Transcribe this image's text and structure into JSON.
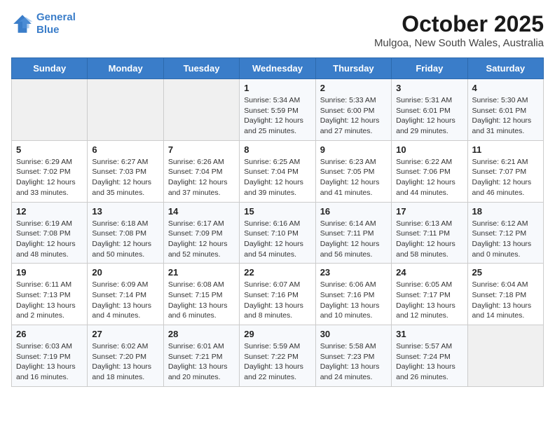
{
  "logo": {
    "line1": "General",
    "line2": "Blue"
  },
  "title": "October 2025",
  "subtitle": "Mulgoa, New South Wales, Australia",
  "days_of_week": [
    "Sunday",
    "Monday",
    "Tuesday",
    "Wednesday",
    "Thursday",
    "Friday",
    "Saturday"
  ],
  "weeks": [
    [
      {
        "day": "",
        "info": ""
      },
      {
        "day": "",
        "info": ""
      },
      {
        "day": "",
        "info": ""
      },
      {
        "day": "1",
        "info": "Sunrise: 5:34 AM\nSunset: 5:59 PM\nDaylight: 12 hours\nand 25 minutes."
      },
      {
        "day": "2",
        "info": "Sunrise: 5:33 AM\nSunset: 6:00 PM\nDaylight: 12 hours\nand 27 minutes."
      },
      {
        "day": "3",
        "info": "Sunrise: 5:31 AM\nSunset: 6:01 PM\nDaylight: 12 hours\nand 29 minutes."
      },
      {
        "day": "4",
        "info": "Sunrise: 5:30 AM\nSunset: 6:01 PM\nDaylight: 12 hours\nand 31 minutes."
      }
    ],
    [
      {
        "day": "5",
        "info": "Sunrise: 6:29 AM\nSunset: 7:02 PM\nDaylight: 12 hours\nand 33 minutes."
      },
      {
        "day": "6",
        "info": "Sunrise: 6:27 AM\nSunset: 7:03 PM\nDaylight: 12 hours\nand 35 minutes."
      },
      {
        "day": "7",
        "info": "Sunrise: 6:26 AM\nSunset: 7:04 PM\nDaylight: 12 hours\nand 37 minutes."
      },
      {
        "day": "8",
        "info": "Sunrise: 6:25 AM\nSunset: 7:04 PM\nDaylight: 12 hours\nand 39 minutes."
      },
      {
        "day": "9",
        "info": "Sunrise: 6:23 AM\nSunset: 7:05 PM\nDaylight: 12 hours\nand 41 minutes."
      },
      {
        "day": "10",
        "info": "Sunrise: 6:22 AM\nSunset: 7:06 PM\nDaylight: 12 hours\nand 44 minutes."
      },
      {
        "day": "11",
        "info": "Sunrise: 6:21 AM\nSunset: 7:07 PM\nDaylight: 12 hours\nand 46 minutes."
      }
    ],
    [
      {
        "day": "12",
        "info": "Sunrise: 6:19 AM\nSunset: 7:08 PM\nDaylight: 12 hours\nand 48 minutes."
      },
      {
        "day": "13",
        "info": "Sunrise: 6:18 AM\nSunset: 7:08 PM\nDaylight: 12 hours\nand 50 minutes."
      },
      {
        "day": "14",
        "info": "Sunrise: 6:17 AM\nSunset: 7:09 PM\nDaylight: 12 hours\nand 52 minutes."
      },
      {
        "day": "15",
        "info": "Sunrise: 6:16 AM\nSunset: 7:10 PM\nDaylight: 12 hours\nand 54 minutes."
      },
      {
        "day": "16",
        "info": "Sunrise: 6:14 AM\nSunset: 7:11 PM\nDaylight: 12 hours\nand 56 minutes."
      },
      {
        "day": "17",
        "info": "Sunrise: 6:13 AM\nSunset: 7:11 PM\nDaylight: 12 hours\nand 58 minutes."
      },
      {
        "day": "18",
        "info": "Sunrise: 6:12 AM\nSunset: 7:12 PM\nDaylight: 13 hours\nand 0 minutes."
      }
    ],
    [
      {
        "day": "19",
        "info": "Sunrise: 6:11 AM\nSunset: 7:13 PM\nDaylight: 13 hours\nand 2 minutes."
      },
      {
        "day": "20",
        "info": "Sunrise: 6:09 AM\nSunset: 7:14 PM\nDaylight: 13 hours\nand 4 minutes."
      },
      {
        "day": "21",
        "info": "Sunrise: 6:08 AM\nSunset: 7:15 PM\nDaylight: 13 hours\nand 6 minutes."
      },
      {
        "day": "22",
        "info": "Sunrise: 6:07 AM\nSunset: 7:16 PM\nDaylight: 13 hours\nand 8 minutes."
      },
      {
        "day": "23",
        "info": "Sunrise: 6:06 AM\nSunset: 7:16 PM\nDaylight: 13 hours\nand 10 minutes."
      },
      {
        "day": "24",
        "info": "Sunrise: 6:05 AM\nSunset: 7:17 PM\nDaylight: 13 hours\nand 12 minutes."
      },
      {
        "day": "25",
        "info": "Sunrise: 6:04 AM\nSunset: 7:18 PM\nDaylight: 13 hours\nand 14 minutes."
      }
    ],
    [
      {
        "day": "26",
        "info": "Sunrise: 6:03 AM\nSunset: 7:19 PM\nDaylight: 13 hours\nand 16 minutes."
      },
      {
        "day": "27",
        "info": "Sunrise: 6:02 AM\nSunset: 7:20 PM\nDaylight: 13 hours\nand 18 minutes."
      },
      {
        "day": "28",
        "info": "Sunrise: 6:01 AM\nSunset: 7:21 PM\nDaylight: 13 hours\nand 20 minutes."
      },
      {
        "day": "29",
        "info": "Sunrise: 5:59 AM\nSunset: 7:22 PM\nDaylight: 13 hours\nand 22 minutes."
      },
      {
        "day": "30",
        "info": "Sunrise: 5:58 AM\nSunset: 7:23 PM\nDaylight: 13 hours\nand 24 minutes."
      },
      {
        "day": "31",
        "info": "Sunrise: 5:57 AM\nSunset: 7:24 PM\nDaylight: 13 hours\nand 26 minutes."
      },
      {
        "day": "",
        "info": ""
      }
    ]
  ]
}
